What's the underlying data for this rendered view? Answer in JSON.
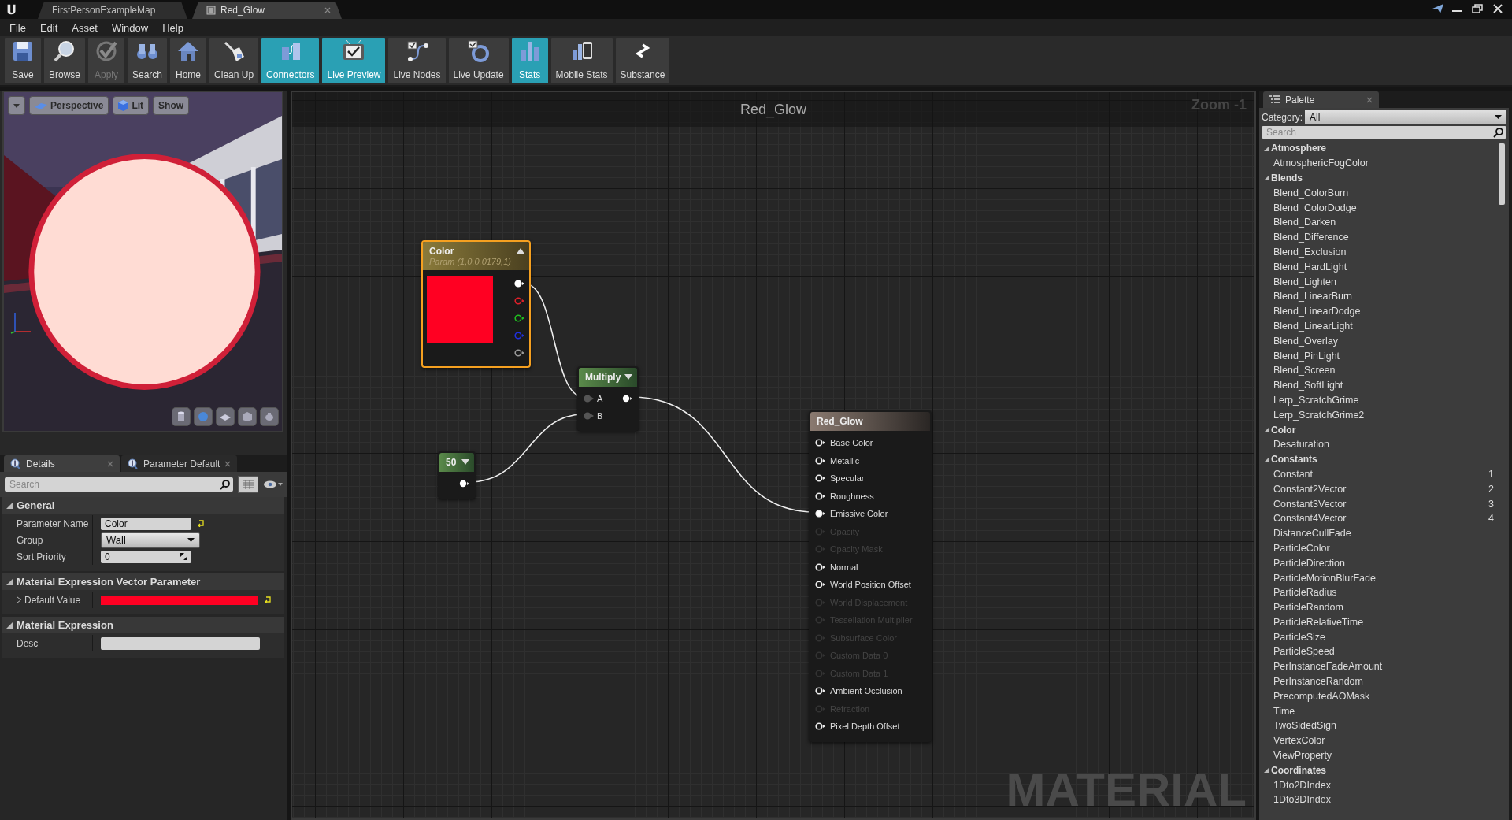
{
  "title_tabs": [
    {
      "label": "FirstPersonExampleMap",
      "kind": "level",
      "selected": false
    },
    {
      "label": "Red_Glow",
      "kind": "material",
      "selected": true
    }
  ],
  "menu": [
    "File",
    "Edit",
    "Asset",
    "Window",
    "Help"
  ],
  "toolbar": [
    {
      "label": "Save",
      "kind": "save",
      "on": false,
      "disabled": false
    },
    {
      "label": "Browse",
      "kind": "browse",
      "on": false,
      "disabled": false
    },
    {
      "label": "Apply",
      "kind": "apply",
      "on": false,
      "disabled": true
    },
    {
      "label": "Search",
      "kind": "search",
      "on": false,
      "disabled": false
    },
    {
      "label": "Home",
      "kind": "home",
      "on": false,
      "disabled": false
    },
    {
      "label": "Clean Up",
      "kind": "cleanup",
      "on": false,
      "disabled": false
    },
    {
      "label": "Connectors",
      "kind": "connectors",
      "on": true,
      "disabled": false
    },
    {
      "label": "Live Preview",
      "kind": "live_preview",
      "on": true,
      "disabled": false
    },
    {
      "label": "Live Nodes",
      "kind": "live_nodes",
      "on": false,
      "disabled": false
    },
    {
      "label": "Live Update",
      "kind": "live_update",
      "on": false,
      "disabled": false
    },
    {
      "label": "Stats",
      "kind": "stats",
      "on": true,
      "disabled": false
    },
    {
      "label": "Mobile Stats",
      "kind": "mobile_stats",
      "on": false,
      "disabled": false
    },
    {
      "label": "Substance",
      "kind": "substance",
      "on": false,
      "disabled": false
    }
  ],
  "viewport": {
    "buttons": [
      {
        "label": "Perspective",
        "kind": "perspective"
      },
      {
        "label": "Lit",
        "kind": "lit"
      },
      {
        "label": "Show",
        "kind": "show"
      }
    ]
  },
  "details": {
    "tabs": [
      {
        "label": "Details",
        "selected": true
      },
      {
        "label": "Parameter Default",
        "selected": false
      }
    ],
    "search": {
      "placeholder": "Search"
    },
    "sections": [
      {
        "title": "General",
        "expanded": true,
        "rows": [
          {
            "label": "Parameter Name",
            "kind": "text",
            "value": "Color",
            "modified": true
          },
          {
            "label": "Group",
            "kind": "dropdown",
            "value": "Wall",
            "modified": false
          },
          {
            "label": "Sort Priority",
            "kind": "number",
            "value": "0",
            "modified": false
          }
        ]
      },
      {
        "title": "Material Expression Vector Parameter",
        "expanded": true,
        "rows": [
          {
            "label": "Default Value",
            "kind": "color",
            "color": "#ff0022",
            "modified": true
          }
        ]
      },
      {
        "title": "Material Expression",
        "expanded": true,
        "rows": [
          {
            "label": "Desc",
            "kind": "text",
            "modified": false
          }
        ]
      }
    ]
  },
  "graph": {
    "title": "Red_Glow",
    "zoom": "Zoom -1",
    "watermark": "MATERIAL",
    "nodes": [
      {
        "kind": "vector_param",
        "title": "Color",
        "subtitle": "Param (1,0,0.0179,1)",
        "selected": true,
        "color": "#ff0022",
        "outputs": [
          {
            "color": "#ffffff",
            "connected": true
          },
          {
            "color": "#e0202a",
            "connected": false
          },
          {
            "color": "#20c020",
            "connected": false
          },
          {
            "color": "#2030e0",
            "connected": false
          },
          {
            "color": "#9a9a9a",
            "connected": false
          }
        ]
      },
      {
        "kind": "math",
        "title": "Multiply",
        "selected": false,
        "inputs": [
          {
            "label": "A",
            "connected": true
          },
          {
            "label": "B",
            "connected": true
          }
        ]
      },
      {
        "kind": "constant",
        "title": "50",
        "selected": false
      },
      {
        "kind": "result",
        "title": "Red_Glow",
        "selected": false,
        "inputs": [
          {
            "label": "Base Color",
            "enabled": true,
            "connected": false
          },
          {
            "label": "Metallic",
            "enabled": true,
            "connected": false
          },
          {
            "label": "Specular",
            "enabled": true,
            "connected": false
          },
          {
            "label": "Roughness",
            "enabled": true,
            "connected": false
          },
          {
            "label": "Emissive Color",
            "enabled": true,
            "connected": true
          },
          {
            "label": "Opacity",
            "enabled": false,
            "connected": false
          },
          {
            "label": "Opacity Mask",
            "enabled": false,
            "connected": false
          },
          {
            "label": "Normal",
            "enabled": true,
            "connected": false
          },
          {
            "label": "World Position Offset",
            "enabled": true,
            "connected": false
          },
          {
            "label": "World Displacement",
            "enabled": false,
            "connected": false
          },
          {
            "label": "Tessellation Multiplier",
            "enabled": false,
            "connected": false
          },
          {
            "label": "Subsurface Color",
            "enabled": false,
            "connected": false
          },
          {
            "label": "Custom Data 0",
            "enabled": false,
            "connected": false
          },
          {
            "label": "Custom Data 1",
            "enabled": false,
            "connected": false
          },
          {
            "label": "Ambient Occlusion",
            "enabled": true,
            "connected": false
          },
          {
            "label": "Refraction",
            "enabled": false,
            "connected": false
          },
          {
            "label": "Pixel Depth Offset",
            "enabled": true,
            "connected": false
          }
        ]
      }
    ]
  },
  "palette": {
    "tab": "Palette",
    "category_label": "Category:",
    "category": "All",
    "search": {
      "placeholder": "Search"
    },
    "groups": [
      {
        "title": "Atmosphere",
        "expanded": true,
        "items": [
          {
            "label": "AtmosphericFogColor"
          }
        ]
      },
      {
        "title": "Blends",
        "expanded": true,
        "items": [
          {
            "label": "Blend_ColorBurn"
          },
          {
            "label": "Blend_ColorDodge"
          },
          {
            "label": "Blend_Darken"
          },
          {
            "label": "Blend_Difference"
          },
          {
            "label": "Blend_Exclusion"
          },
          {
            "label": "Blend_HardLight"
          },
          {
            "label": "Blend_Lighten"
          },
          {
            "label": "Blend_LinearBurn"
          },
          {
            "label": "Blend_LinearDodge"
          },
          {
            "label": "Blend_LinearLight"
          },
          {
            "label": "Blend_Overlay"
          },
          {
            "label": "Blend_PinLight"
          },
          {
            "label": "Blend_Screen"
          },
          {
            "label": "Blend_SoftLight"
          },
          {
            "label": "Lerp_ScratchGrime"
          },
          {
            "label": "Lerp_ScratchGrime2"
          }
        ]
      },
      {
        "title": "Color",
        "expanded": true,
        "items": [
          {
            "label": "Desaturation"
          }
        ]
      },
      {
        "title": "Constants",
        "expanded": true,
        "items": [
          {
            "label": "Constant",
            "hotkey": "1"
          },
          {
            "label": "Constant2Vector",
            "hotkey": "2"
          },
          {
            "label": "Constant3Vector",
            "hotkey": "3"
          },
          {
            "label": "Constant4Vector",
            "hotkey": "4"
          },
          {
            "label": "DistanceCullFade"
          },
          {
            "label": "ParticleColor"
          },
          {
            "label": "ParticleDirection"
          },
          {
            "label": "ParticleMotionBlurFade"
          },
          {
            "label": "ParticleRadius"
          },
          {
            "label": "ParticleRandom"
          },
          {
            "label": "ParticleRelativeTime"
          },
          {
            "label": "ParticleSize"
          },
          {
            "label": "ParticleSpeed"
          },
          {
            "label": "PerInstanceFadeAmount"
          },
          {
            "label": "PerInstanceRandom"
          },
          {
            "label": "PrecomputedAOMask"
          },
          {
            "label": "Time"
          },
          {
            "label": "TwoSidedSign"
          },
          {
            "label": "VertexColor"
          },
          {
            "label": "ViewProperty"
          }
        ]
      },
      {
        "title": "Coordinates",
        "expanded": true,
        "items": [
          {
            "label": "1Dto2DIndex"
          },
          {
            "label": "1Dto3DIndex"
          }
        ]
      }
    ]
  }
}
